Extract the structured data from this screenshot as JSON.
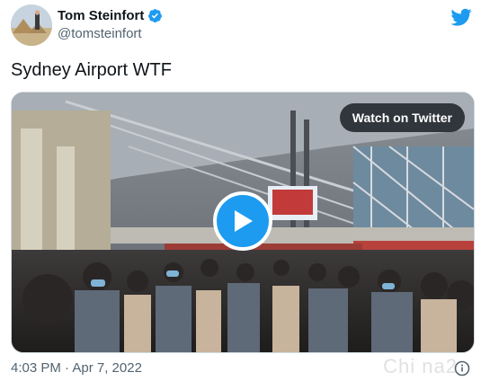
{
  "tweet": {
    "author_name": "Tom Steinfort",
    "author_handle": "@tomsteinfort",
    "text": "Sydney Airport WTF",
    "timestamp": "4:03 PM · Apr 7, 2022"
  },
  "media": {
    "watch_label": "Watch on Twitter"
  },
  "watermark": "Chi na2",
  "colors": {
    "brand": "#1d9bf0",
    "handle_gray": "#536471"
  },
  "icons": {
    "verified": "verified-badge-icon",
    "brand": "twitter-bird-icon",
    "play": "play-icon",
    "info": "info-icon"
  }
}
